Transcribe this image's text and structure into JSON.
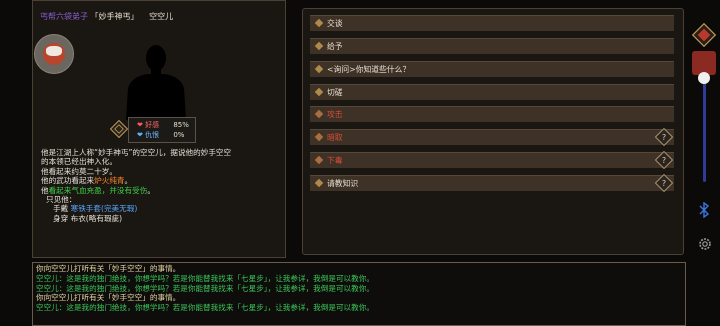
{
  "character": {
    "sect": "丐帮六袋弟子",
    "nickname": "「妙手神丐」",
    "name": "空空儿",
    "favor_label": "好感",
    "favor_value": "85%",
    "hatred_label": "仇恨",
    "hatred_value": "0%",
    "desc": {
      "line1": "他是江湖上人称“妙手神丐”的空空儿，据说他的妙手空空",
      "line2": "的本领已经出神入化。",
      "line3": "他看起来约莫二十岁。",
      "line4_prefix": "他的武功看起来",
      "line4_value": "炉火纯青",
      "line4_suffix": "。",
      "line5_prefix": "他",
      "line5_value": "看起来气血充盈，并没有受伤",
      "line5_suffix": "。",
      "line6": "只见他：",
      "gear_hand_label": "手戴",
      "gear_hand_item": "寒铁手套(完美无瑕)",
      "gear_body_label": "身穿",
      "gear_body_item": "布衣(略有瑕疵)"
    }
  },
  "actions": [
    {
      "label": "交谈"
    },
    {
      "label": "给予"
    },
    {
      "label": "<询问>你知道些什么？"
    },
    {
      "label": "切磋"
    },
    {
      "label": "攻击"
    },
    {
      "label": "暗取"
    },
    {
      "label": "下毒"
    },
    {
      "label": "请教知识"
    }
  ],
  "log": [
    "你向空空儿打听有关「妙手空空」的事情。",
    "空空儿：这是我的独门绝技，你想学吗？若是你能替我找来「七星步」，让我参详，我倒是可以教你。",
    "空空儿：这是我的独门绝技，你想学吗？若是你能替我找来「七星步」，让我参详，我倒是可以教你。",
    "你向空空儿打听有关「妙手空空」的事情。",
    "空空儿：这是我的独门绝技，你想学吗？若是你能替我找来「七星步」，让我参详，我倒是可以教你。"
  ],
  "colors": {
    "favor": "#ff5a5a",
    "hatred": "#5ab4ff",
    "attack_red": "#d84a3a",
    "log_player": "#e8d8a8",
    "log_npc": "#3bc85a"
  }
}
